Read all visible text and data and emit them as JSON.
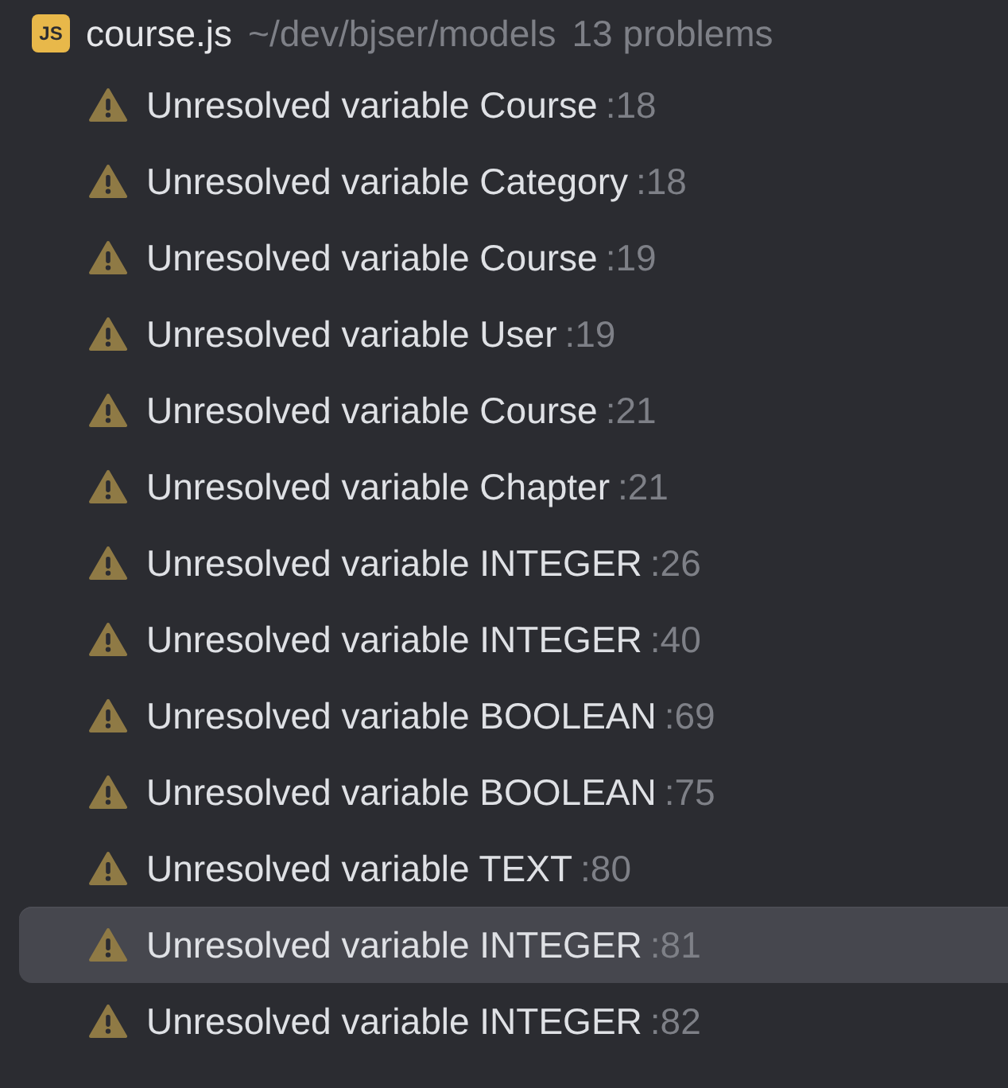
{
  "file": {
    "name": "course.js",
    "path": "~/dev/bjser/models",
    "count": "13 problems",
    "badge": "JS"
  },
  "problems": [
    {
      "message": "Unresolved variable Course",
      "line": ":18",
      "selected": false
    },
    {
      "message": "Unresolved variable Category",
      "line": ":18",
      "selected": false
    },
    {
      "message": "Unresolved variable Course",
      "line": ":19",
      "selected": false
    },
    {
      "message": "Unresolved variable User",
      "line": ":19",
      "selected": false
    },
    {
      "message": "Unresolved variable Course",
      "line": ":21",
      "selected": false
    },
    {
      "message": "Unresolved variable Chapter",
      "line": ":21",
      "selected": false
    },
    {
      "message": "Unresolved variable INTEGER",
      "line": ":26",
      "selected": false
    },
    {
      "message": "Unresolved variable INTEGER",
      "line": ":40",
      "selected": false
    },
    {
      "message": "Unresolved variable BOOLEAN",
      "line": ":69",
      "selected": false
    },
    {
      "message": "Unresolved variable BOOLEAN",
      "line": ":75",
      "selected": false
    },
    {
      "message": "Unresolved variable TEXT",
      "line": ":80",
      "selected": false
    },
    {
      "message": "Unresolved variable INTEGER",
      "line": ":81",
      "selected": true
    },
    {
      "message": "Unresolved variable INTEGER",
      "line": ":82",
      "selected": false
    }
  ]
}
